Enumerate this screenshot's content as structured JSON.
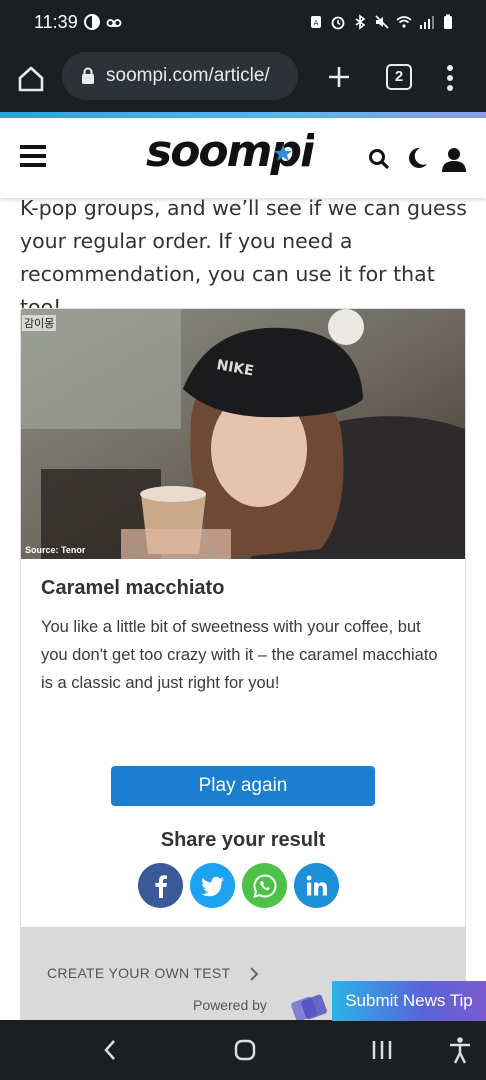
{
  "status_bar": {
    "time": "11:39"
  },
  "browser": {
    "url": "soompi.com/article/",
    "tab_count": "2"
  },
  "site": {
    "logo_text": "soompi"
  },
  "article": {
    "intro_text": "K-pop groups, and we’ll see if we can guess your regular order. If you need a recommendation, you can use it for that too!"
  },
  "result": {
    "image_source": "Source: Tenor",
    "image_caption_korean": "감이몽",
    "title": "Caramel macchiato",
    "description": "You like a little bit of sweetness with your coffee, but you don't get too crazy with it – the caramel macchiato is a classic and just right for you!",
    "play_again_label": "Play again",
    "share_title": "Share your result",
    "share_buttons": [
      {
        "network": "facebook",
        "color": "#3b5998"
      },
      {
        "network": "twitter",
        "color": "#1da1f2"
      },
      {
        "network": "whatsapp",
        "color": "#4dc247"
      },
      {
        "network": "linkedin",
        "color": "#1c8fd6"
      }
    ],
    "create_test_label": "CREATE YOUR OWN TEST",
    "powered_by_label": "Powered by"
  },
  "floating": {
    "submit_news_tip_label": "Submit News Tip"
  },
  "icons": {
    "home": "home-icon",
    "lock": "lock-icon",
    "new_tab": "plus-icon",
    "menu": "more-vert-icon",
    "hamburger": "hamburger-icon",
    "search": "search-icon",
    "dark_mode": "moon-icon",
    "account": "user-icon",
    "chevron": "chevron-right-icon",
    "nav_back": "back-icon",
    "nav_home": "nav-home-icon",
    "nav_recent": "recent-apps-icon",
    "accessibility": "accessibility-icon"
  }
}
